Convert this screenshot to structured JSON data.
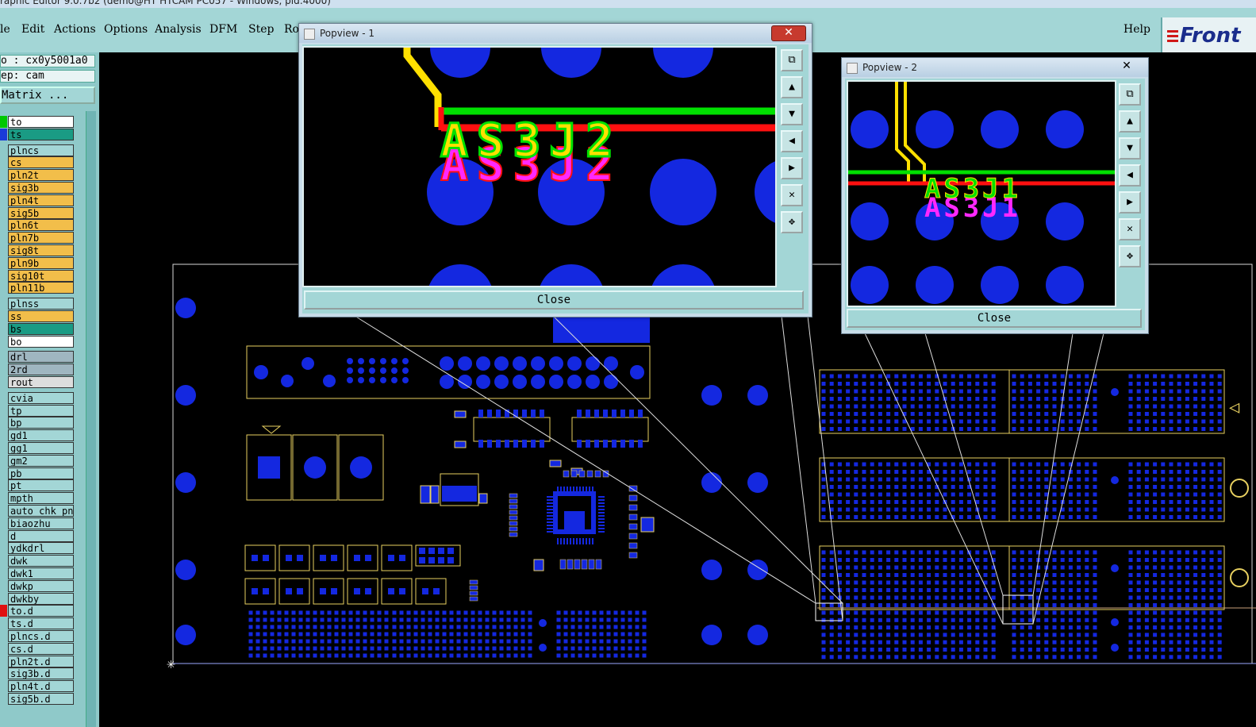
{
  "window_title": "raphic Editor 9.0.7b2 (demo@HT HTCAM PC057 - Windows, pid:4000)",
  "menu": [
    "le",
    "Edit",
    "Actions",
    "Options",
    "Analysis",
    "DFM",
    "Step",
    "Ro",
    "Help"
  ],
  "logo": "Front",
  "job_info": {
    "job": "o : cx0y5001a0",
    "step": "ep: cam",
    "matrix_button": "Matrix ..."
  },
  "layers": [
    {
      "name": "to",
      "color": "#ffffff",
      "marker": "#00c800"
    },
    {
      "name": "ts",
      "color": "#1a9b84",
      "marker": "#1a3ad8"
    },
    {
      "name": "plncs",
      "color": "#a3d6d6",
      "marker": ""
    },
    {
      "name": "cs",
      "color": "#f2be4a",
      "marker": ""
    },
    {
      "name": "pln2t",
      "color": "#f2be4a",
      "marker": ""
    },
    {
      "name": "sig3b",
      "color": "#f2be4a",
      "marker": ""
    },
    {
      "name": "pln4t",
      "color": "#f2be4a",
      "marker": ""
    },
    {
      "name": "sig5b",
      "color": "#f2be4a",
      "marker": ""
    },
    {
      "name": "pln6t",
      "color": "#f2be4a",
      "marker": ""
    },
    {
      "name": "pln7b",
      "color": "#f2be4a",
      "marker": ""
    },
    {
      "name": "sig8t",
      "color": "#f2be4a",
      "marker": ""
    },
    {
      "name": "pln9b",
      "color": "#f2be4a",
      "marker": ""
    },
    {
      "name": "sig10t",
      "color": "#f2be4a",
      "marker": ""
    },
    {
      "name": "pln11b",
      "color": "#f2be4a",
      "marker": ""
    },
    {
      "name": "plnss",
      "color": "#a3d6d6",
      "marker": ""
    },
    {
      "name": "ss",
      "color": "#f2be4a",
      "marker": ""
    },
    {
      "name": "bs",
      "color": "#1a9b84",
      "marker": ""
    },
    {
      "name": "bo",
      "color": "#ffffff",
      "marker": ""
    },
    {
      "name": "drl",
      "color": "#9fb6c0",
      "marker": ""
    },
    {
      "name": "2rd",
      "color": "#9fb6c0",
      "marker": ""
    },
    {
      "name": "rout",
      "color": "#dddddd",
      "marker": ""
    },
    {
      "name": "cvia",
      "color": "#a3d6d6",
      "marker": ""
    },
    {
      "name": "tp",
      "color": "#a3d6d6",
      "marker": ""
    },
    {
      "name": "bp",
      "color": "#a3d6d6",
      "marker": ""
    },
    {
      "name": "gd1",
      "color": "#a3d6d6",
      "marker": ""
    },
    {
      "name": "gg1",
      "color": "#a3d6d6",
      "marker": ""
    },
    {
      "name": "gm2",
      "color": "#a3d6d6",
      "marker": ""
    },
    {
      "name": "pb",
      "color": "#a3d6d6",
      "marker": ""
    },
    {
      "name": "pt",
      "color": "#a3d6d6",
      "marker": ""
    },
    {
      "name": "mpth",
      "color": "#a3d6d6",
      "marker": ""
    },
    {
      "name": "auto_chk_pn",
      "color": "#a3d6d6",
      "marker": ""
    },
    {
      "name": "biaozhu",
      "color": "#a3d6d6",
      "marker": ""
    },
    {
      "name": "d",
      "color": "#a3d6d6",
      "marker": ""
    },
    {
      "name": "ydkdrl",
      "color": "#a3d6d6",
      "marker": ""
    },
    {
      "name": "dwk",
      "color": "#a3d6d6",
      "marker": ""
    },
    {
      "name": "dwk1",
      "color": "#a3d6d6",
      "marker": ""
    },
    {
      "name": "dwkp",
      "color": "#a3d6d6",
      "marker": ""
    },
    {
      "name": "dwkby",
      "color": "#a3d6d6",
      "marker": ""
    },
    {
      "name": "to.d",
      "color": "#a3d6d6",
      "marker": "#e01010"
    },
    {
      "name": "ts.d",
      "color": "#a3d6d6",
      "marker": ""
    },
    {
      "name": "plncs.d",
      "color": "#a3d6d6",
      "marker": ""
    },
    {
      "name": "cs.d",
      "color": "#a3d6d6",
      "marker": ""
    },
    {
      "name": "pln2t.d",
      "color": "#a3d6d6",
      "marker": ""
    },
    {
      "name": "sig3b.d",
      "color": "#a3d6d6",
      "marker": ""
    },
    {
      "name": "pln4t.d",
      "color": "#a3d6d6",
      "marker": ""
    },
    {
      "name": "sig5b.d",
      "color": "#a3d6d6",
      "marker": ""
    }
  ],
  "popview1": {
    "title": "Popview - 1",
    "close_label": "Close",
    "ref_top": "AS3J2",
    "ref_bottom": "AS3J2"
  },
  "popview2": {
    "title": "Popview - 2",
    "close_label": "Close",
    "ref_top": "AS3J1",
    "ref_bottom": "AS3J1"
  },
  "side_tools": [
    "zoom-window-icon",
    "pan-up-icon",
    "pan-down-icon",
    "pan-left-icon",
    "pan-right-icon",
    "zoom-fit-icon",
    "zoom-home-icon"
  ],
  "colors": {
    "pad": "#1428e0",
    "trace_green": "#00e000",
    "trace_red": "#ff1010",
    "silk_yellow": "#ffe000",
    "magenta": "#ff28ff",
    "panel": "#a3d6d6",
    "outline": "#e8d060"
  }
}
